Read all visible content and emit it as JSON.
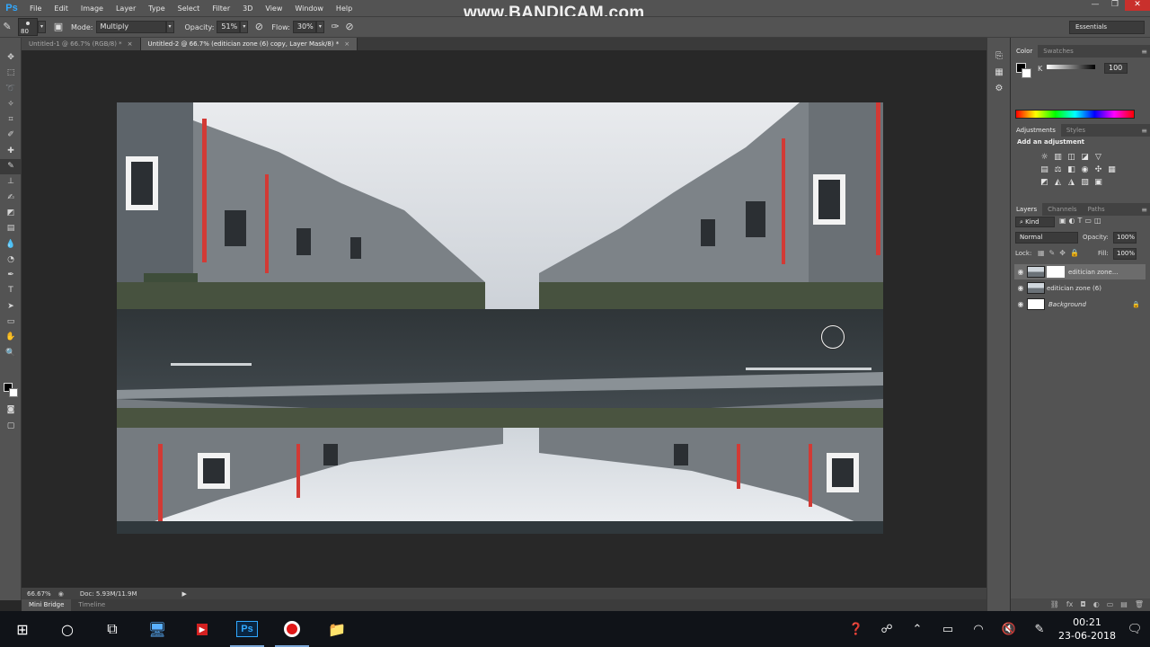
{
  "app": {
    "logo": "Ps",
    "watermark": "www.BANDICAM.com",
    "menu": [
      "File",
      "Edit",
      "Image",
      "Layer",
      "Type",
      "Select",
      "Filter",
      "3D",
      "View",
      "Window",
      "Help"
    ],
    "window_controls": [
      "—",
      "❐",
      "✕"
    ]
  },
  "options": {
    "brush_size": "80",
    "mode_label": "Mode:",
    "mode_value": "Multiply",
    "opacity_label": "Opacity:",
    "opacity_value": "51%",
    "flow_label": "Flow:",
    "flow_value": "30%",
    "workspace": "Essentials"
  },
  "tabs": [
    {
      "label": "Untitled-1 @ 66.7% (RGB/8) *",
      "active": false
    },
    {
      "label": "Untitled-2 @ 66.7% (editician zone (6) copy, Layer Mask/8) *",
      "active": true
    }
  ],
  "status": {
    "zoom": "66.67%",
    "doc": "Doc: 5.93M/11.9M"
  },
  "bottom_tabs": [
    "Mini Bridge",
    "Timeline"
  ],
  "color_panel": {
    "tabs": [
      "Color",
      "Swatches"
    ],
    "channel_label": "K",
    "channel_value": "100"
  },
  "adjustments_panel": {
    "tabs": [
      "Adjustments",
      "Styles"
    ],
    "heading": "Add an adjustment"
  },
  "layers_panel": {
    "tabs": [
      "Layers",
      "Channels",
      "Paths"
    ],
    "filter_label": "Kind",
    "blend_mode": "Normal",
    "opacity_label": "Opacity:",
    "opacity_value": "100%",
    "lock_label": "Lock:",
    "fill_label": "Fill:",
    "fill_value": "100%",
    "layers": [
      {
        "name": "editician zone...",
        "selected": true
      },
      {
        "name": "editician zone (6)",
        "selected": false
      },
      {
        "name": "Background",
        "selected": false
      }
    ]
  },
  "taskbar": {
    "time": "00:21",
    "date": "23-06-2018"
  },
  "colors": {
    "panel_bg": "#535353",
    "canvas_bg": "#282828",
    "accent": "#31a8ff"
  }
}
